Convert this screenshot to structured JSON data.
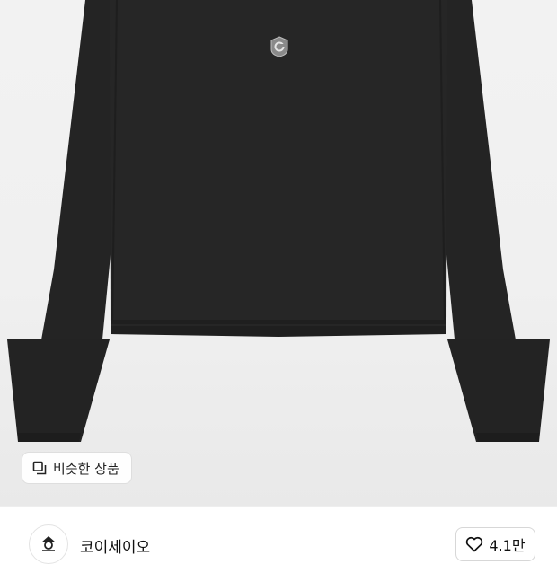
{
  "product": {
    "image_alt": "black long sleeve top",
    "logo_icon": "brand-badge-icon"
  },
  "similar_products": {
    "label": "비슷한 상품",
    "icon": "similar-items-icon"
  },
  "store": {
    "name": "코이세이오",
    "logo_icon": "store-logo-icon"
  },
  "like": {
    "count": "4.1만",
    "icon": "heart-outline-icon"
  },
  "colors": {
    "garment": "#262626",
    "background": "#f0f0f0"
  }
}
